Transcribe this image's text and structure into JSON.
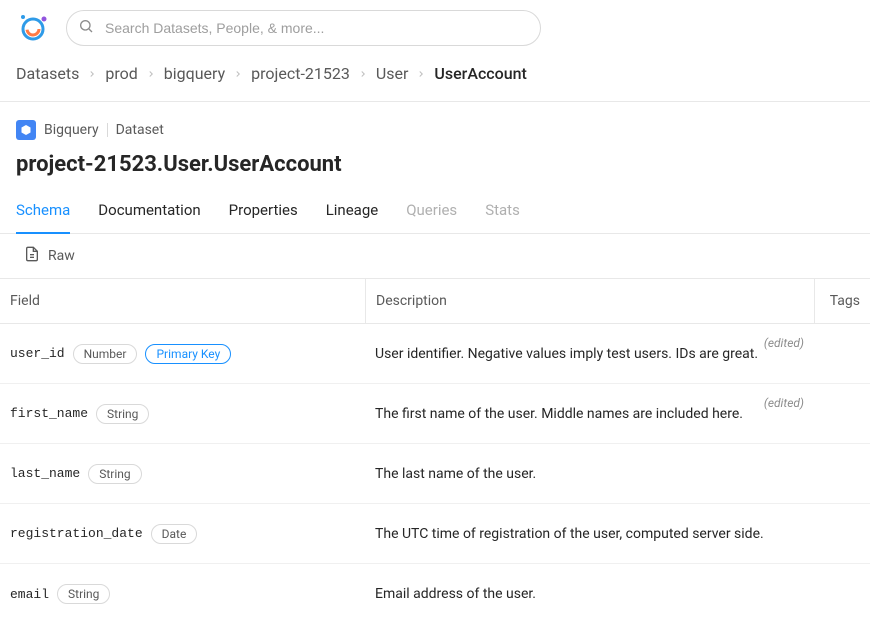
{
  "search": {
    "placeholder": "Search Datasets, People, & more..."
  },
  "breadcrumbs": {
    "items": [
      {
        "label": "Datasets"
      },
      {
        "label": "prod"
      },
      {
        "label": "bigquery"
      },
      {
        "label": "project-21523"
      },
      {
        "label": "User"
      },
      {
        "label": "UserAccount"
      }
    ]
  },
  "entity": {
    "platform": "Bigquery",
    "type": "Dataset",
    "title": "project-21523.User.UserAccount"
  },
  "tabs": {
    "items": [
      {
        "label": "Schema"
      },
      {
        "label": "Documentation"
      },
      {
        "label": "Properties"
      },
      {
        "label": "Lineage"
      },
      {
        "label": "Queries"
      },
      {
        "label": "Stats"
      }
    ]
  },
  "rawButton": {
    "label": "Raw"
  },
  "schema": {
    "headers": {
      "field": "Field",
      "description": "Description",
      "tags": "Tags"
    },
    "editedLabel": "(edited)",
    "fields": [
      {
        "name": "user_id",
        "type": "Number",
        "flag": "Primary Key",
        "description": "User identifier. Negative values imply test users. IDs are great.",
        "edited": true
      },
      {
        "name": "first_name",
        "type": "String",
        "description": "The first name of the user. Middle names are included here.",
        "edited": true
      },
      {
        "name": "last_name",
        "type": "String",
        "description": "The last name of the user."
      },
      {
        "name": "registration_date",
        "type": "Date",
        "description": "The UTC time of registration of the user, computed server side."
      },
      {
        "name": "email",
        "type": "String",
        "description": "Email address of the user."
      }
    ]
  }
}
